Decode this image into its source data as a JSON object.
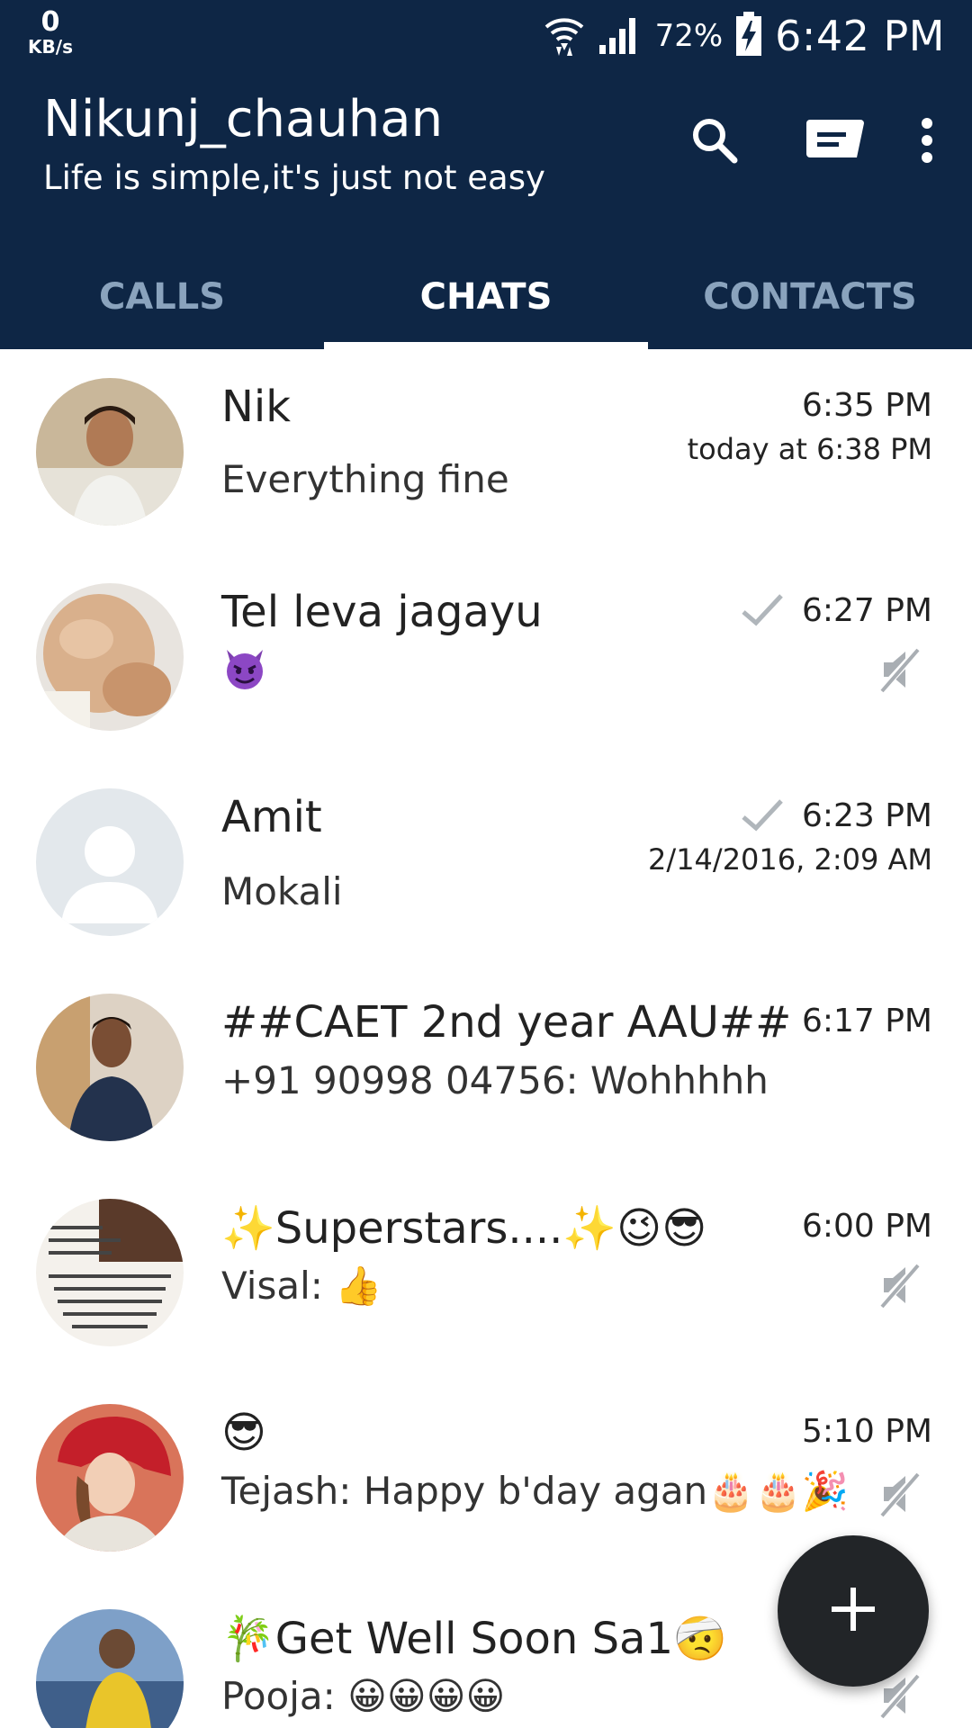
{
  "status_bar": {
    "speed_value": "0",
    "speed_unit": "KB/s",
    "battery_percent": "72%",
    "time": "6:42 PM"
  },
  "header": {
    "title": "Nikunj_chauhan",
    "subtitle": "Life is simple,it's just not easy",
    "actions": [
      "search-icon",
      "new-broadcast-icon",
      "more-vert-icon"
    ]
  },
  "tabs": [
    {
      "label": "CALLS",
      "active": false
    },
    {
      "label": "CHATS",
      "active": true
    },
    {
      "label": "CONTACTS",
      "active": false
    }
  ],
  "chats": [
    {
      "name": "Nik",
      "message": "Everything fine",
      "time": "6:35 PM",
      "subtext": "today at 6:38 PM",
      "tick": false,
      "muted": false
    },
    {
      "name": "Tel leva jagayu",
      "message": "😈",
      "time": "6:27 PM",
      "subtext": "",
      "tick": true,
      "muted": true
    },
    {
      "name": "Amit",
      "message": "Mokali",
      "time": "6:23 PM",
      "subtext": "2/14/2016, 2:09 AM",
      "tick": true,
      "muted": false
    },
    {
      "name": "##CAET 2nd year AAU##",
      "message": "+91 90998 04756: Wohhhhh",
      "time": "6:17 PM",
      "subtext": "",
      "tick": false,
      "muted": false
    },
    {
      "name": "✨Superstars....✨😉😎",
      "message": "Visal: 👍",
      "time": "6:00 PM",
      "subtext": "",
      "tick": false,
      "muted": true
    },
    {
      "name": "😎",
      "message": "Tejash: Happy b'day agan🎂🎂🎉",
      "time": "5:10 PM",
      "subtext": "",
      "tick": false,
      "muted": true
    },
    {
      "name": "🎋Get Well Soon Sa1🤕",
      "message": "Pooja: 😀😀😀😀",
      "time": "",
      "subtext": "",
      "tick": false,
      "muted": true
    }
  ],
  "fab": {
    "icon": "plus-icon"
  }
}
